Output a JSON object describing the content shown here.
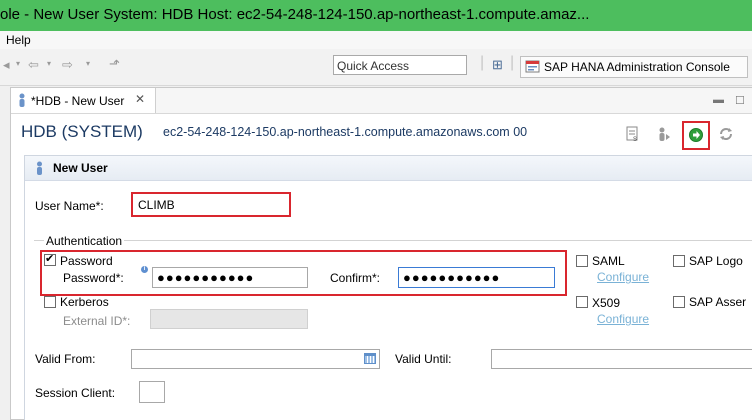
{
  "window": {
    "title": "ole - New User System: HDB Host: ec2-54-248-124-150.ap-northeast-1.compute.amaz..."
  },
  "menu": {
    "help": "Help"
  },
  "toolbar": {
    "quick_access_placeholder": "Quick Access",
    "perspective_label": "SAP HANA Administration Console"
  },
  "tab": {
    "label": "*HDB - New User",
    "close": "✕"
  },
  "header": {
    "system": "HDB (SYSTEM)",
    "host": "ec2-54-248-124-150.ap-northeast-1.compute.amazonaws.com 00"
  },
  "section": {
    "title": "New User"
  },
  "form": {
    "user_name_label": "User Name*:",
    "user_name_value": "CLIMB",
    "auth_group_label": "Authentication",
    "password_checkbox_label": "Password",
    "password_checked": true,
    "password_label": "Password*:",
    "password_mask": "●●●●●●●●●●●",
    "confirm_label": "Confirm*:",
    "confirm_mask": "●●●●●●●●●●●",
    "info_glyph": "i",
    "kerberos_label": "Kerberos",
    "kerberos_checked": false,
    "external_id_label": "External ID*:",
    "saml_label": "SAML",
    "saml_configure": "Configure",
    "x509_label": "X509",
    "x509_configure": "Configure",
    "sap_logon_label": "SAP Logo",
    "sap_assert_label": "SAP Asser",
    "valid_from_label": "Valid From:",
    "valid_until_label": "Valid Until:",
    "session_client_label": "Session Client:"
  },
  "colors": {
    "title_bar": "#4dbe5e",
    "highlight": "#d9262e",
    "link": "#7ab2d6",
    "header_text": "#1c3a63"
  }
}
